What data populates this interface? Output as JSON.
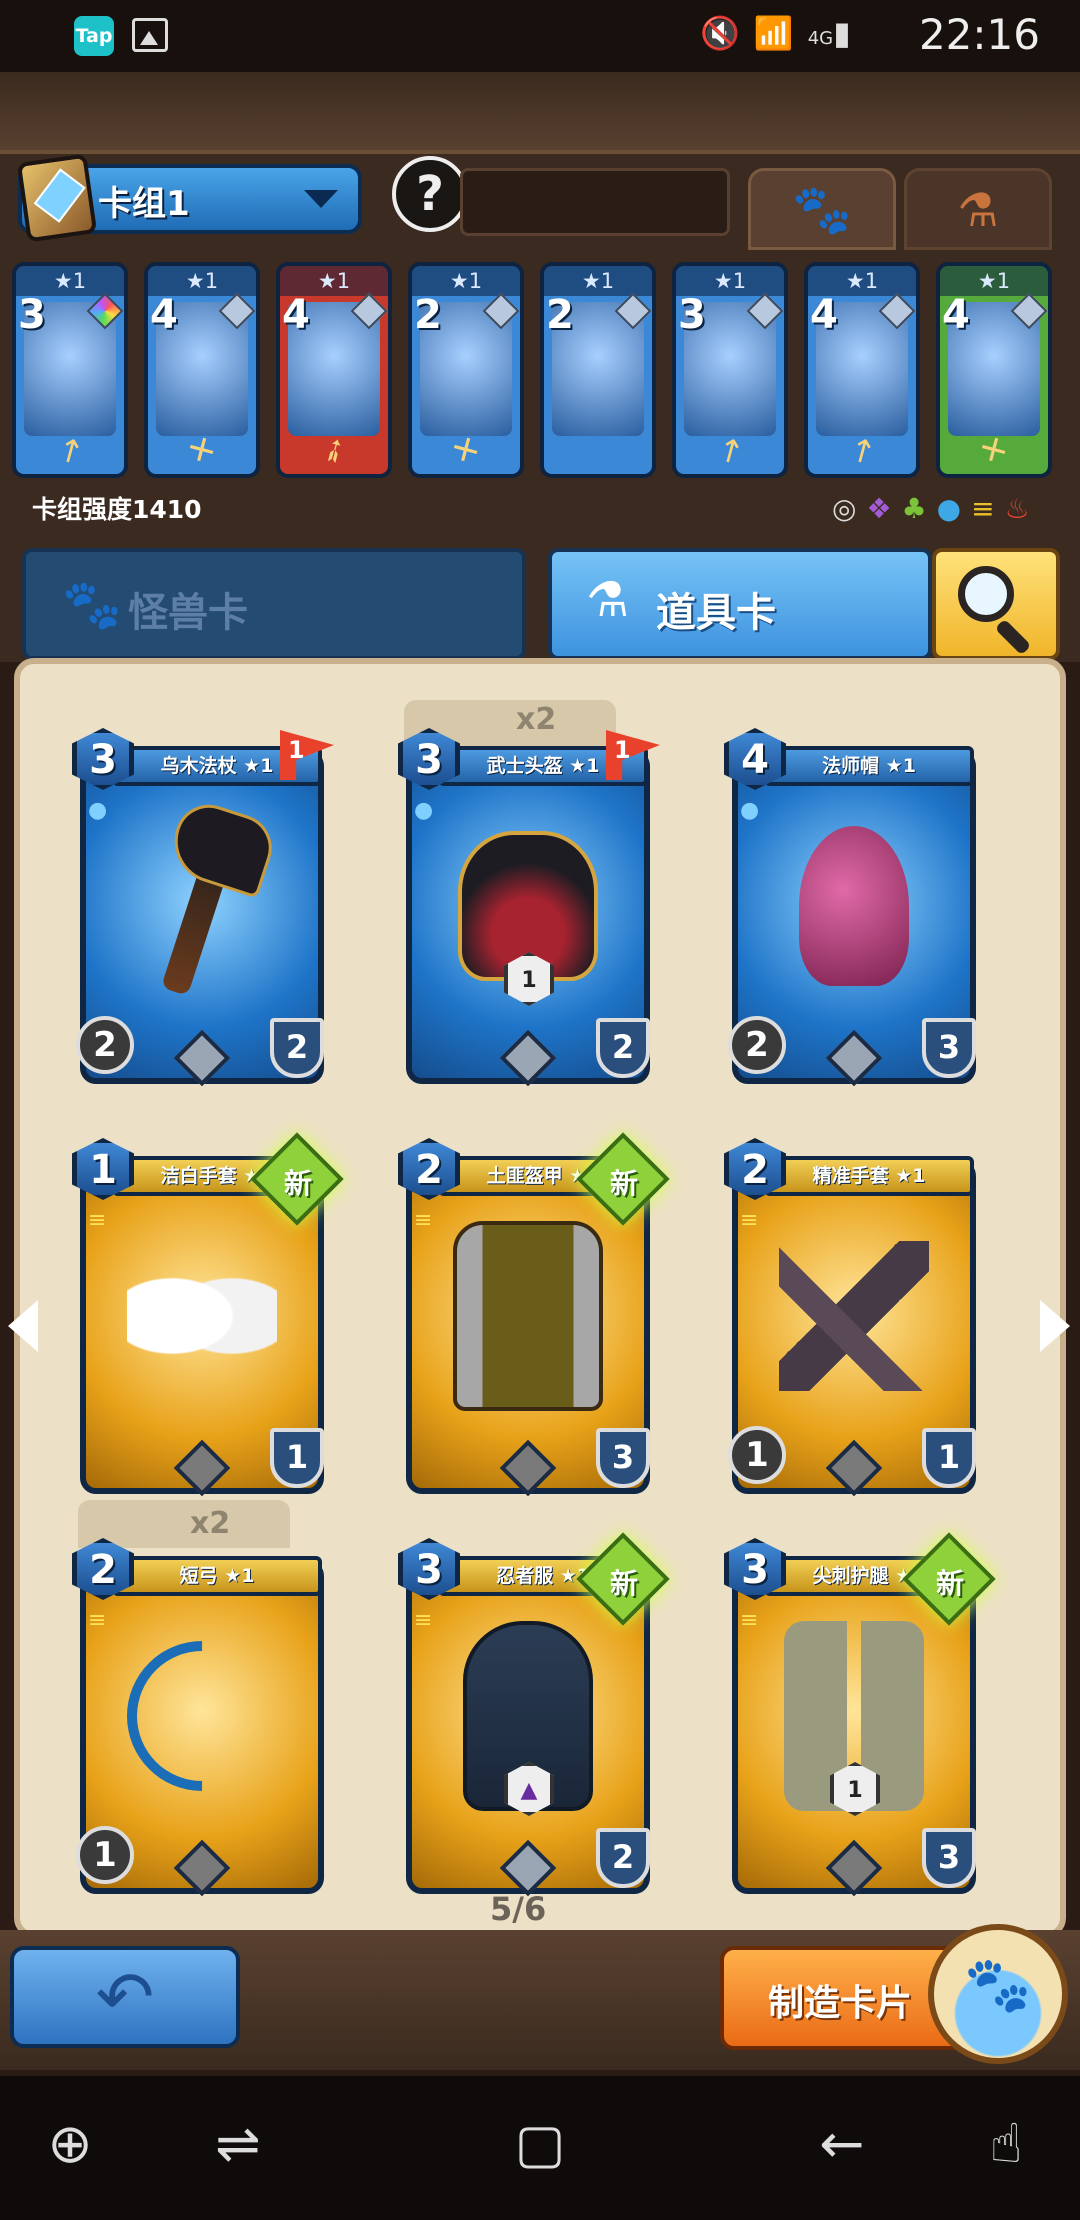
{
  "status_bar": {
    "time": "22:16",
    "network": "4G"
  },
  "header": {
    "deck_label": "卡组1",
    "deck_power": "卡组强度1410"
  },
  "deck_cards": [
    {
      "cost": "3",
      "stars": "★1",
      "color": "blue",
      "gem": "rainbow",
      "weapon": "staff"
    },
    {
      "cost": "4",
      "stars": "★1",
      "color": "blue",
      "gem": "hex",
      "weapon": "sword"
    },
    {
      "cost": "4",
      "stars": "★1",
      "color": "red",
      "gem": "hex",
      "weapon": "bow"
    },
    {
      "cost": "2",
      "stars": "★1",
      "color": "blue",
      "gem": "hex",
      "weapon": "sword"
    },
    {
      "cost": "2",
      "stars": "★1",
      "color": "blue",
      "gem": "hex",
      "weapon": "none"
    },
    {
      "cost": "3",
      "stars": "★1",
      "color": "blue",
      "gem": "hex",
      "weapon": "staff"
    },
    {
      "cost": "4",
      "stars": "★1",
      "color": "blue",
      "gem": "hex",
      "weapon": "staff"
    },
    {
      "cost": "4",
      "stars": "★1",
      "color": "green",
      "gem": "hex",
      "weapon": "sword"
    }
  ],
  "tabs": {
    "monster": "怪兽卡",
    "item": "道具卡"
  },
  "cards": [
    {
      "name": "乌木法杖 ★1",
      "cost": "3",
      "left": "2",
      "right": "2",
      "flag": "1"
    },
    {
      "name": "武士头盔 ★1",
      "cost": "3",
      "right": "2",
      "flag": "1",
      "count": "x2",
      "upgrade": "1"
    },
    {
      "name": "法师帽 ★1",
      "cost": "4",
      "left": "2",
      "right": "3"
    },
    {
      "name": "洁白手套 ★1",
      "cost": "1",
      "right": "1",
      "new": "新"
    },
    {
      "name": "土匪盔甲 ★1",
      "cost": "2",
      "right": "3",
      "new": "新"
    },
    {
      "name": "精准手套 ★1",
      "cost": "2",
      "left": "1",
      "right": "1"
    },
    {
      "name": "短弓 ★1",
      "cost": "2",
      "left": "1",
      "count": "x2"
    },
    {
      "name": "忍者服 ★1",
      "cost": "3",
      "right": "2",
      "new": "新"
    },
    {
      "name": "尖刺护腿 ★1",
      "cost": "3",
      "right": "3",
      "new": "新",
      "upgrade": "1"
    }
  ],
  "pagination": "5/6",
  "buttons": {
    "craft": "制造卡片"
  },
  "icons": {
    "element_icons": [
      "circle",
      "purple",
      "green",
      "blue",
      "yellow",
      "red"
    ]
  }
}
